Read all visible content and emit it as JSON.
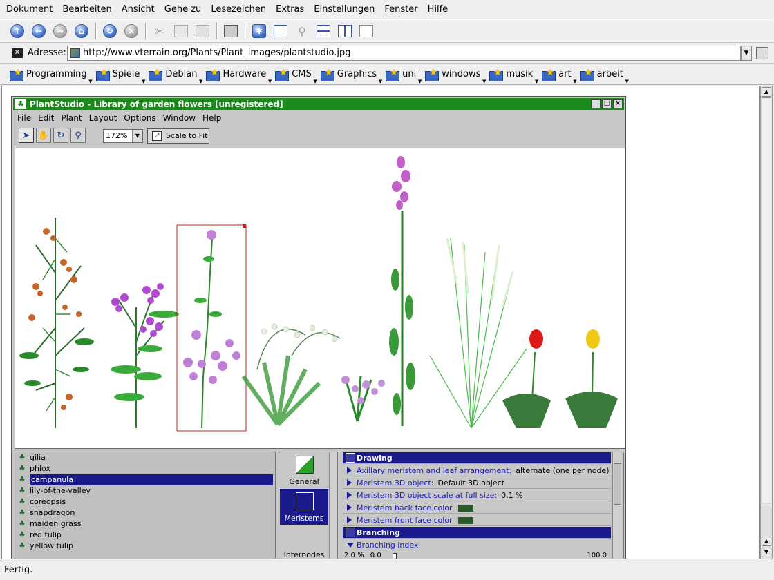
{
  "browser": {
    "menu": [
      "Dokument",
      "Bearbeiten",
      "Ansicht",
      "Gehe zu",
      "Lesezeichen",
      "Extras",
      "Einstellungen",
      "Fenster",
      "Hilfe"
    ],
    "address_label": "Adresse:",
    "url": "http://www.vterrain.org/Plants/Plant_images/plantstudio.jpg",
    "bookmarks": [
      "Programming",
      "Spiele",
      "Debian",
      "Hardware",
      "CMS",
      "Graphics",
      "uni",
      "windows",
      "musik",
      "art",
      "arbeit"
    ],
    "status": "Fertig."
  },
  "plantstudio": {
    "title": "PlantStudio - Library of garden flowers [unregistered]",
    "menu": [
      "File",
      "Edit",
      "Plant",
      "Layout",
      "Options",
      "Window",
      "Help"
    ],
    "zoom": "172%",
    "scale_to_fit": "Scale to Fit",
    "plants": [
      "gilia",
      "phlox",
      "campanula",
      "lily-of-the-valley",
      "coreopsis",
      "snapdragon",
      "maiden grass",
      "red tulip",
      "yellow tulip"
    ],
    "selected_plant": "campanula",
    "tabs": [
      "General",
      "Meristems",
      "Internodes"
    ],
    "active_tab": "Meristems",
    "sections": {
      "drawing": "Drawing",
      "branching": "Branching"
    },
    "props": [
      {
        "label": "Axillary meristem and leaf arrangement:",
        "value": "alternate (one per node)"
      },
      {
        "label": "Meristem 3D object:",
        "value": "Default 3D object"
      },
      {
        "label": "Meristem 3D object scale at full size:",
        "value": "0.1 %"
      },
      {
        "label": "Meristem back face color",
        "value": ""
      },
      {
        "label": "Meristem front face color",
        "value": ""
      }
    ],
    "branching_index": {
      "label": "Branching index",
      "current": "2.0",
      "unit": "%",
      "min": "0.0",
      "max": "100.0"
    },
    "colors": {
      "title_bar": "#1a8a1a",
      "selection": "#1a1a8a",
      "swatch": "#2a5a2a"
    }
  }
}
